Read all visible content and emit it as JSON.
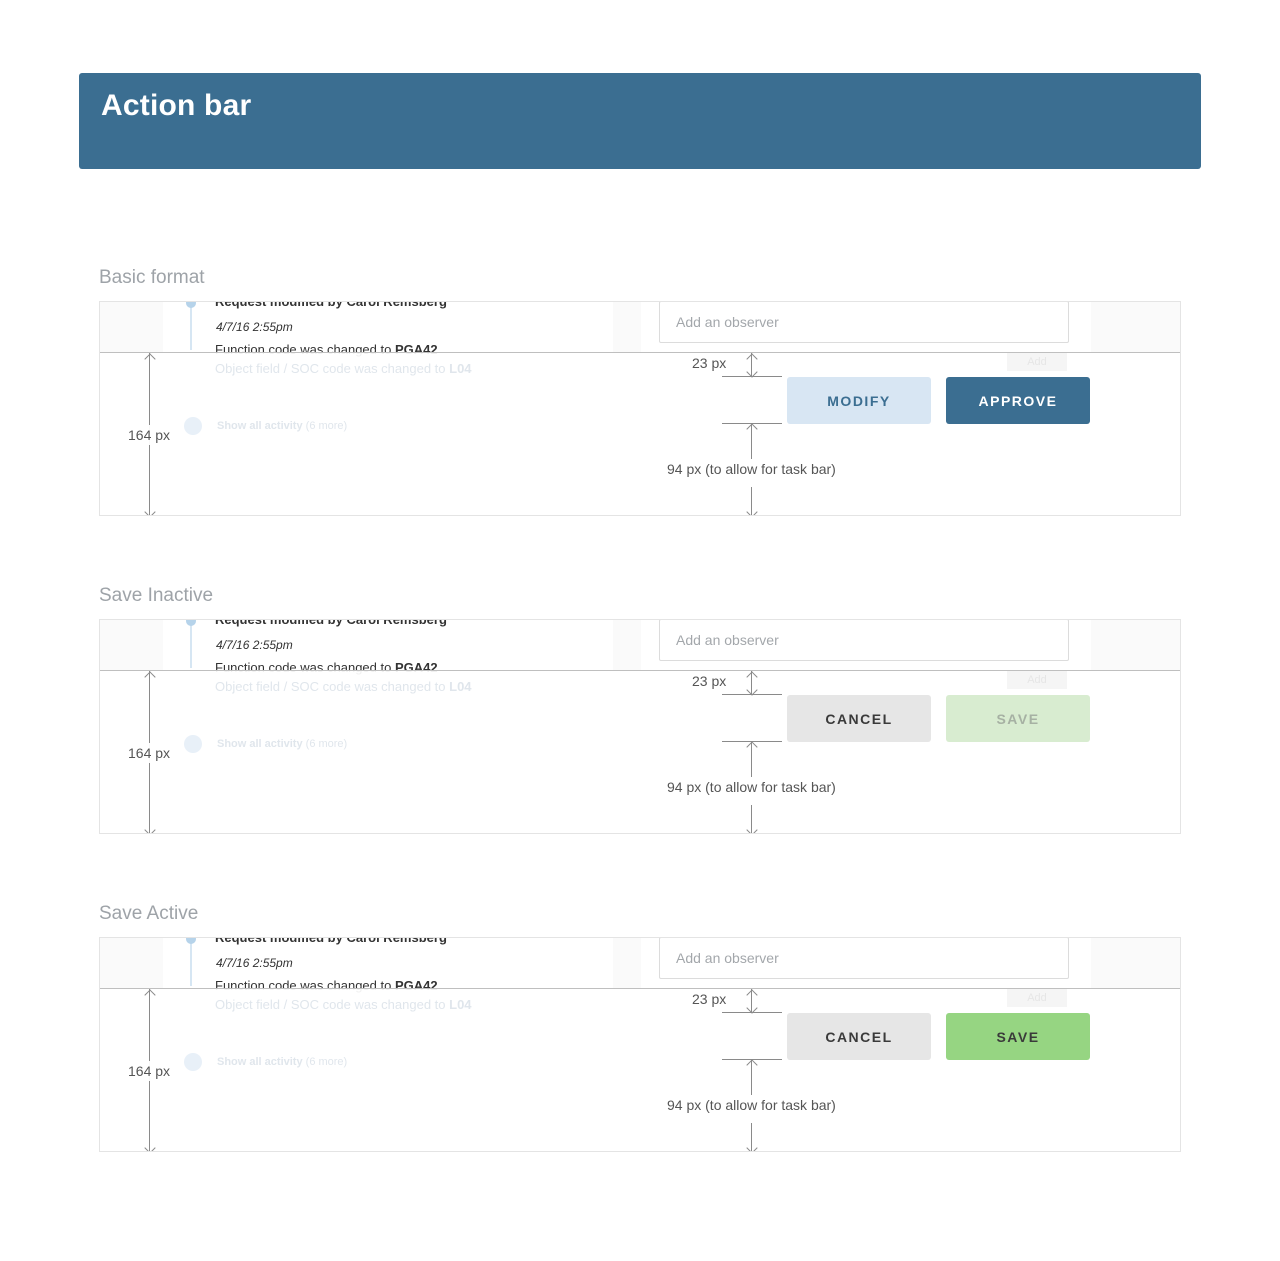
{
  "page": {
    "title": "Action bar"
  },
  "mock": {
    "activity_title": "Request modified by Carol Remsberg",
    "activity_time": "4/7/16 2:55pm",
    "activity_line_prefix": "Function code was changed to ",
    "activity_line_value": "PGA42",
    "faint_line_prefix": "Object field / SOC code was changed to ",
    "faint_line_value": "L04",
    "show_all": "Show all activity",
    "show_all_count": "(6 more)",
    "observer_placeholder": "Add an observer",
    "add_label": "Add"
  },
  "measurements": {
    "top_gap": "23 px",
    "total_height": "164 px",
    "bottom_gap": "94 px (to allow for task bar)"
  },
  "sections": [
    {
      "title": "Basic format",
      "left_button": "MODIFY",
      "right_button": "APPROVE"
    },
    {
      "title": "Save Inactive",
      "left_button": "CANCEL",
      "right_button": "SAVE"
    },
    {
      "title": "Save Active",
      "left_button": "CANCEL",
      "right_button": "SAVE"
    }
  ],
  "colors": {
    "header": "#3b6e91",
    "approve": "#3b6e91",
    "modify": "#d8e6f3",
    "cancel": "#e6e6e6",
    "save_inactive": "#d8ecd0",
    "save_active": "#96d582"
  }
}
